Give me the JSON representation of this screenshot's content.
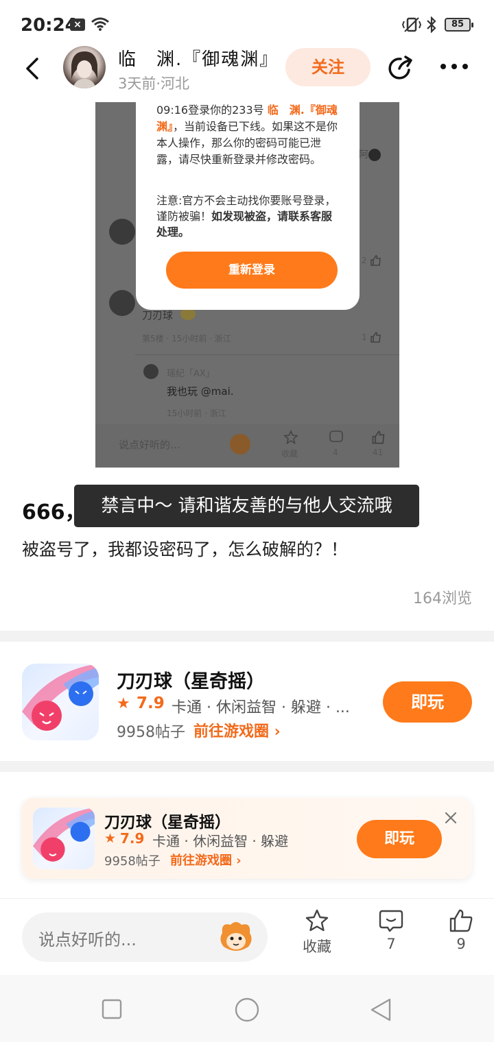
{
  "status_bar": {
    "time": "20:24",
    "battery": "85"
  },
  "header": {
    "author_name": "临　渊.『御魂渊』",
    "author_meta": "3天前·河北",
    "follow_label": "关注"
  },
  "embedded": {
    "modal_line_prefix": "09:16登录你的233号 ",
    "modal_highlight": "临　渊.『御魂渊』",
    "modal_line_suffix": "，当前设备已下线。如果这不是你本人操作，那么你的密码可能已泄露，请尽快重新登录并修改密码。",
    "modal_note_prefix": "注意:官方不会主动找你要账号登录，谨防被骗！",
    "modal_note_bold": "如发现被盗，请联系客服处理。",
    "relogin_label": "重新登录",
    "bg_reply_text": "刀刃球",
    "bg_floor": "第5楼 · 15小时前 · 浙江",
    "bg_sub_user": "瑶纪「AX」",
    "bg_sub_reply": "我也玩 @mai.",
    "bg_sub_time": "15小时前 · 浙江",
    "bg_input": "说点好听的…",
    "bg_collect": "收藏",
    "bg_comments": "4",
    "bg_likes": "41",
    "bg_like_count1": "2",
    "bg_like_count2": "1",
    "bg_partial": "阿"
  },
  "post": {
    "title": "666，",
    "toast": "禁言中～ 请和谐友善的与他人交流哦",
    "body": "被盗号了，我都设密码了，怎么破解的？！",
    "views": "164浏览"
  },
  "game_card": {
    "name": "刀刃球（星奇摇）",
    "rating": "7.9",
    "tags": "卡通 · 休闲益智 · 躲避 · ...",
    "posts": "9958帖子",
    "circle_link": "前往游戏圈 ›",
    "play_label": "即玩"
  },
  "floating_card": {
    "name": "刀刃球（星奇摇）",
    "rating": "7.9",
    "tags": "卡通 · 休闲益智 · 躲避",
    "posts": "9958帖子",
    "circle_link": "前往游戏圈 ›",
    "play_label": "即玩"
  },
  "bottom_bar": {
    "comment_placeholder": "说点好听的...",
    "collect_label": "收藏",
    "comment_count": "7",
    "like_count": "9"
  },
  "colors": {
    "accent": "#ff7a1a",
    "accent_text": "#f26a1b",
    "follow_bg": "#fde9e0"
  }
}
